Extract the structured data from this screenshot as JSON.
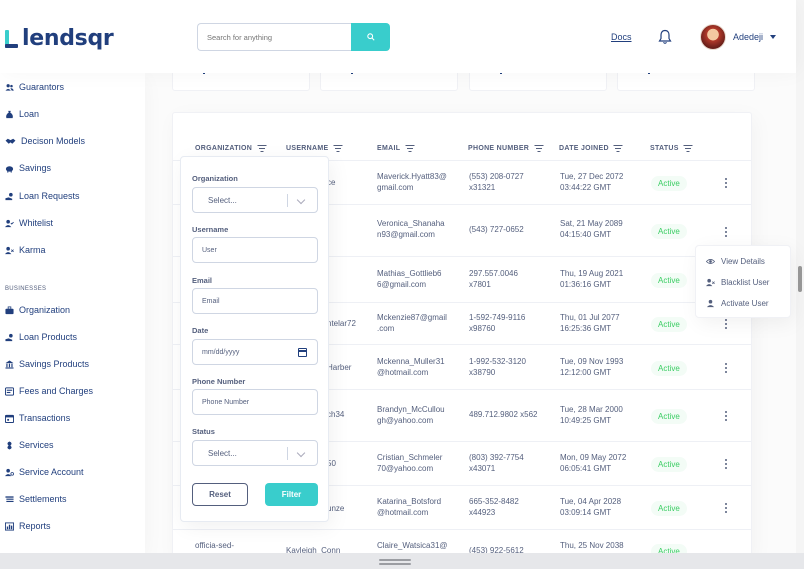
{
  "brand": {
    "name": "lendsqr",
    "accent": "#39CDCC",
    "primary": "#213F7D"
  },
  "header": {
    "search_placeholder": "Search for anything",
    "docs_label": "Docs",
    "user_name": "Adedeji"
  },
  "sidebar": {
    "items_top": [
      {
        "label": "Guarantors",
        "icon": "users-icon"
      },
      {
        "label": "Loan",
        "icon": "sack-icon"
      },
      {
        "label": "Decison Models",
        "icon": "handshake-icon"
      },
      {
        "label": "Savings",
        "icon": "piggy-bank-icon"
      },
      {
        "label": "Loan Requests",
        "icon": "hand-coin-icon"
      },
      {
        "label": "Whitelist",
        "icon": "user-check-icon"
      },
      {
        "label": "Karma",
        "icon": "user-x-icon"
      }
    ],
    "business_title": "BUSINESSES",
    "items_business": [
      {
        "label": "Organization",
        "icon": "briefcase-icon"
      },
      {
        "label": "Loan Products",
        "icon": "hand-coin-icon"
      },
      {
        "label": "Savings Products",
        "icon": "bank-icon"
      },
      {
        "label": "Fees and Charges",
        "icon": "coins-icon"
      },
      {
        "label": "Transactions",
        "icon": "calendar-icon"
      },
      {
        "label": "Services",
        "icon": "galaxy-icon"
      },
      {
        "label": "Service Account",
        "icon": "user-cog-icon"
      },
      {
        "label": "Settlements",
        "icon": "scroll-icon"
      },
      {
        "label": "Reports",
        "icon": "chart-bar-icon"
      }
    ]
  },
  "table": {
    "headers": [
      "ORGANIZATION",
      "USERNAME",
      "EMAIL",
      "PHONE NUMBER",
      "DATE JOINED",
      "STATUS"
    ],
    "rows": [
      {
        "org": "",
        "user": "ce",
        "email1": "Maverick.Hyatt83@",
        "email2": "gmail.com",
        "phone1": "(553) 208-0727",
        "phone2": "x31321",
        "date1": "Tue, 27 Dec 2072",
        "date2": "03:44:22 GMT",
        "status": "Active"
      },
      {
        "org": "",
        "user": "",
        "email1": "Veronica_Shanaha",
        "email2": "n93@gmail.com",
        "phone1": "(543) 727-0652",
        "phone2": "",
        "date1": "Sat, 21 May 2089",
        "date2": "04:15:40 GMT",
        "status": "Active"
      },
      {
        "org": "",
        "user": "",
        "email1": "Mathias_Gottlieb6",
        "email2": "6@gmail.com",
        "phone1": "297.557.0046",
        "phone2": "x7801",
        "date1": "Thu, 19 Aug 2021",
        "date2": "01:36:16 GMT",
        "status": "Active"
      },
      {
        "org": "",
        "user": "ntelar72",
        "email1": "Mckenzie87@gmail",
        "email2": ".com",
        "phone1": "1-592-749-9116",
        "phone2": "x98760",
        "date1": "Thu, 01 Jul 2077",
        "date2": "16:25:36 GMT",
        "status": "Active"
      },
      {
        "org": "",
        "user": "Harber",
        "email1": "Mckenna_Muller31",
        "email2": "@hotmail.com",
        "phone1": "1-992-532-3120",
        "phone2": "x38790",
        "date1": "Tue, 09 Nov 1993",
        "date2": "12:12:00 GMT",
        "status": "Active"
      },
      {
        "org": "",
        "user": "ch34",
        "email1": "Brandyn_McCullou",
        "email2": "gh@yahoo.com",
        "phone1": "489.712.9802 x562",
        "phone2": "",
        "date1": "Tue, 28 Mar 2000",
        "date2": "10:49:25 GMT",
        "status": "Active"
      },
      {
        "org": "",
        "user": "50",
        "email1": "Cristian_Schmeler",
        "email2": "70@yahoo.com",
        "phone1": "(803) 392-7754",
        "phone2": "x43071",
        "date1": "Mon, 09 May 2072",
        "date2": "06:05:41 GMT",
        "status": "Active"
      },
      {
        "org": "",
        "user": "unze",
        "email1": "Katarina_Botsford",
        "email2": "@hotmail.com",
        "phone1": "665-352-8482",
        "phone2": "x44923",
        "date1": "Tue, 04 Apr 2028",
        "date2": "03:09:14 GMT",
        "status": "Active"
      },
      {
        "org": "officia-sed-",
        "user": "Kayleigh_Conn",
        "email1": "Claire_Watsica31@",
        "email2": "",
        "phone1": "(453) 922-5612",
        "phone2": "",
        "date1": "Thu, 25 Nov 2038",
        "date2": "",
        "status": "Active"
      }
    ]
  },
  "filter": {
    "org_label": "Organization",
    "org_placeholder": "Select...",
    "username_label": "Username",
    "username_placeholder": "User",
    "email_label": "Email",
    "email_placeholder": "Email",
    "date_label": "Date",
    "date_placeholder": "mm/dd/yyyy",
    "phone_label": "Phone Number",
    "phone_placeholder": "Phone Number",
    "status_label": "Status",
    "status_placeholder": "Select...",
    "reset_label": "Reset",
    "filter_label": "Filter"
  },
  "context_menu": {
    "view": "View Details",
    "blacklist": "Blacklist User",
    "activate": "Activate User"
  }
}
